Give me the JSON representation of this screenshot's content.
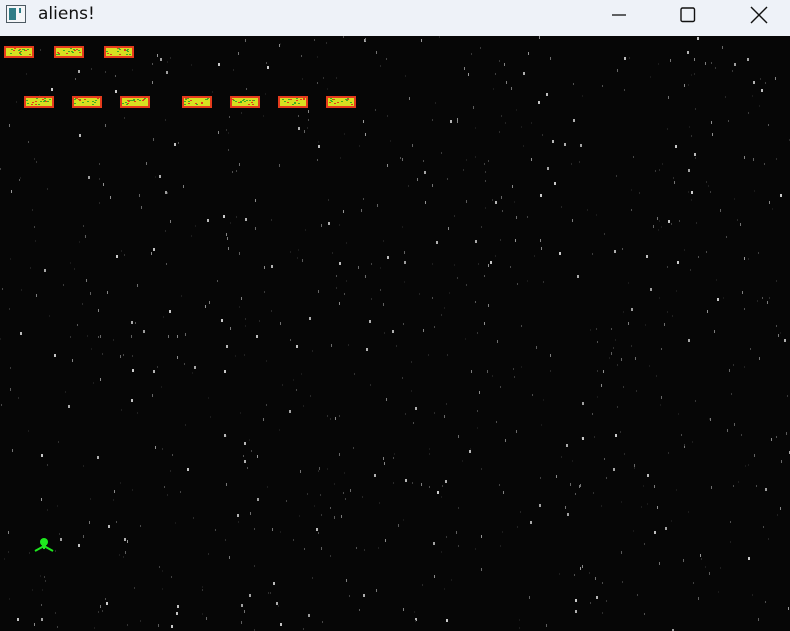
{
  "window": {
    "title": "aliens!",
    "icon": "app-window-icon",
    "controls": {
      "minimize_icon": "minimize-icon",
      "maximize_icon": "maximize-icon",
      "close_icon": "close-icon"
    }
  },
  "game": {
    "background_color": "#060606",
    "alien_colors": {
      "border": "#e53b1c",
      "body": "#d8e021",
      "speckle": "#3fae22"
    },
    "player_color": "#1ee81e",
    "alien_rows": [
      3,
      7
    ],
    "player_icon": "player-ship-icon",
    "alien_icon": "alien-ship-icon"
  }
}
